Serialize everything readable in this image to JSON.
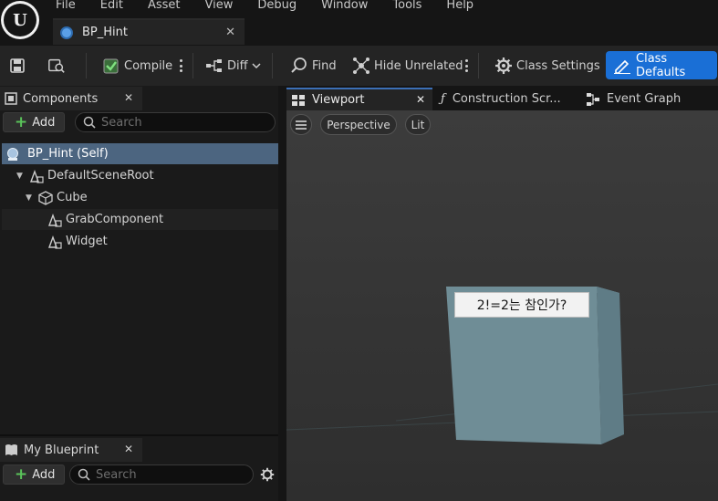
{
  "app": {
    "menu": [
      "File",
      "Edit",
      "Asset",
      "View",
      "Debug",
      "Window",
      "Tools",
      "Help"
    ],
    "asset_tab": {
      "label": "BP_Hint"
    }
  },
  "toolbar": {
    "compile": "Compile",
    "diff": "Diff",
    "find": "Find",
    "hide_unrelated": "Hide Unrelated",
    "class_settings": "Class Settings",
    "class_defaults": "Class Defaults"
  },
  "components_panel": {
    "title": "Components",
    "add": "Add",
    "search_placeholder": "Search",
    "tree": [
      {
        "label": "BP_Hint (Self)",
        "icon": "blueprint-icon"
      },
      {
        "label": "DefaultSceneRoot",
        "icon": "scene-component-icon"
      },
      {
        "label": "Cube",
        "icon": "static-mesh-icon"
      },
      {
        "label": "GrabComponent",
        "icon": "scene-component-icon"
      },
      {
        "label": "Widget",
        "icon": "scene-component-icon"
      }
    ]
  },
  "my_blueprint_panel": {
    "title": "My Blueprint",
    "add": "Add",
    "search_placeholder": "Search"
  },
  "editor_tabs": {
    "viewport": "Viewport",
    "construction_script": "Construction Scr...",
    "event_graph": "Event Graph"
  },
  "viewport": {
    "perspective": "Perspective",
    "lit": "Lit",
    "widget_text": "2!=2는 참인가?"
  }
}
